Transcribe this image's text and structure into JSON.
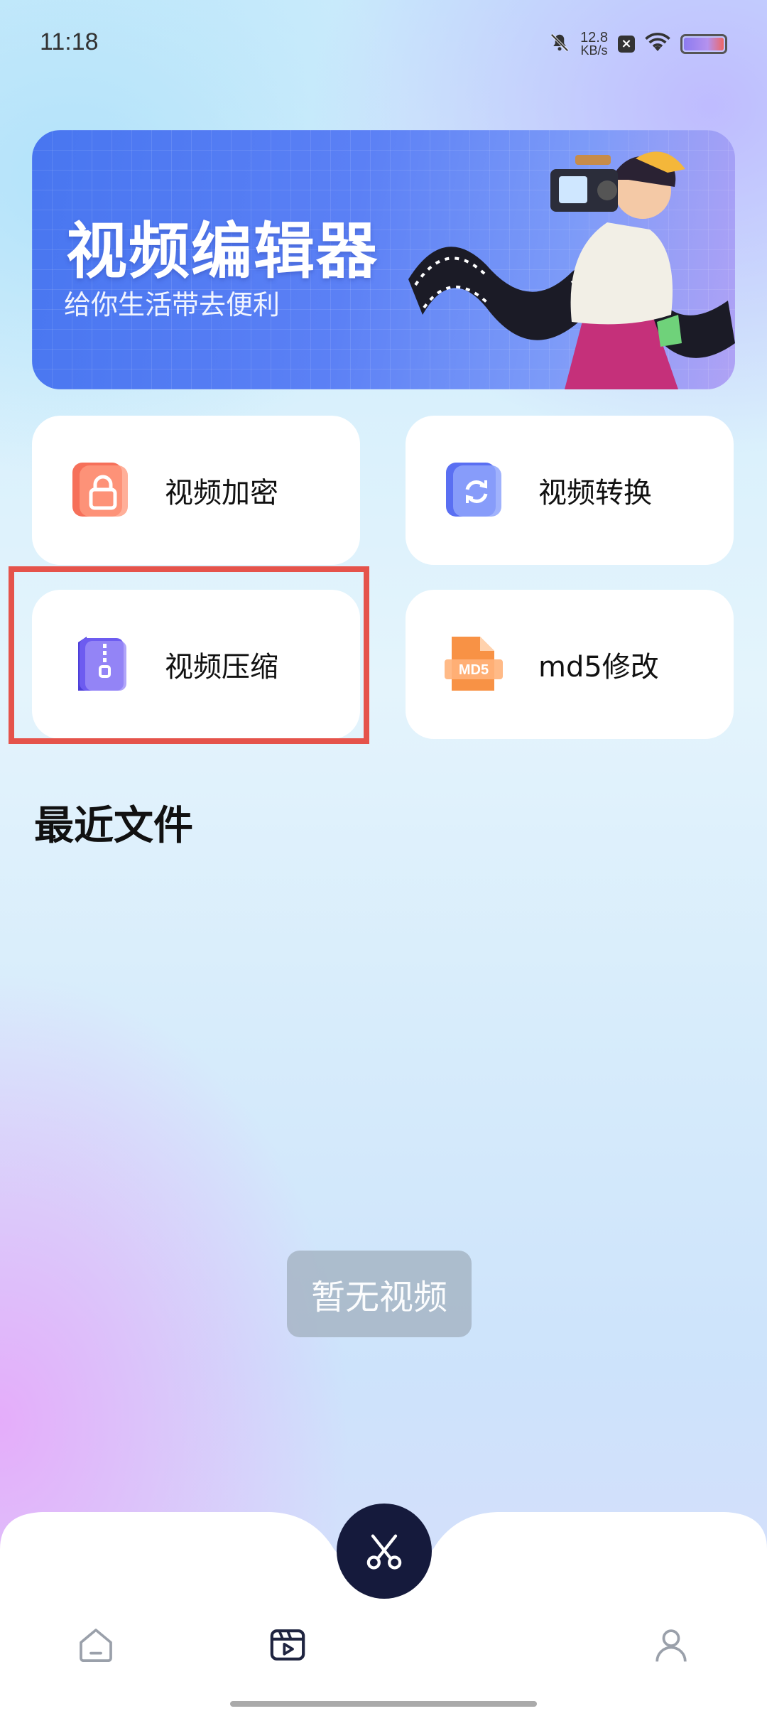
{
  "status_bar": {
    "time": "11:18",
    "speed_value": "12.8",
    "speed_unit": "KB/s",
    "icons": [
      "mute-bell-icon",
      "close-box-icon",
      "wifi-icon",
      "battery-icon"
    ]
  },
  "banner": {
    "title": "视频编辑器",
    "subtitle": "给你生活带去便利"
  },
  "features": [
    {
      "label": "视频加密",
      "icon": "lock-icon",
      "color": "#f6705a"
    },
    {
      "label": "视频转换",
      "icon": "convert-icon",
      "color": "#5a6ff2"
    },
    {
      "label": "视频压缩",
      "icon": "zip-icon",
      "color": "#6d5cf0"
    },
    {
      "label": "md5修改",
      "icon": "md5-file-icon",
      "color": "#f89245",
      "icon_text": "MD5"
    }
  ],
  "recent": {
    "title": "最近文件",
    "empty_text": "暂无视频"
  },
  "nav": {
    "items": [
      "home-icon",
      "video-icon",
      "edit-scissors-icon",
      "profile-icon"
    ],
    "fab_color": "#151a3c"
  }
}
